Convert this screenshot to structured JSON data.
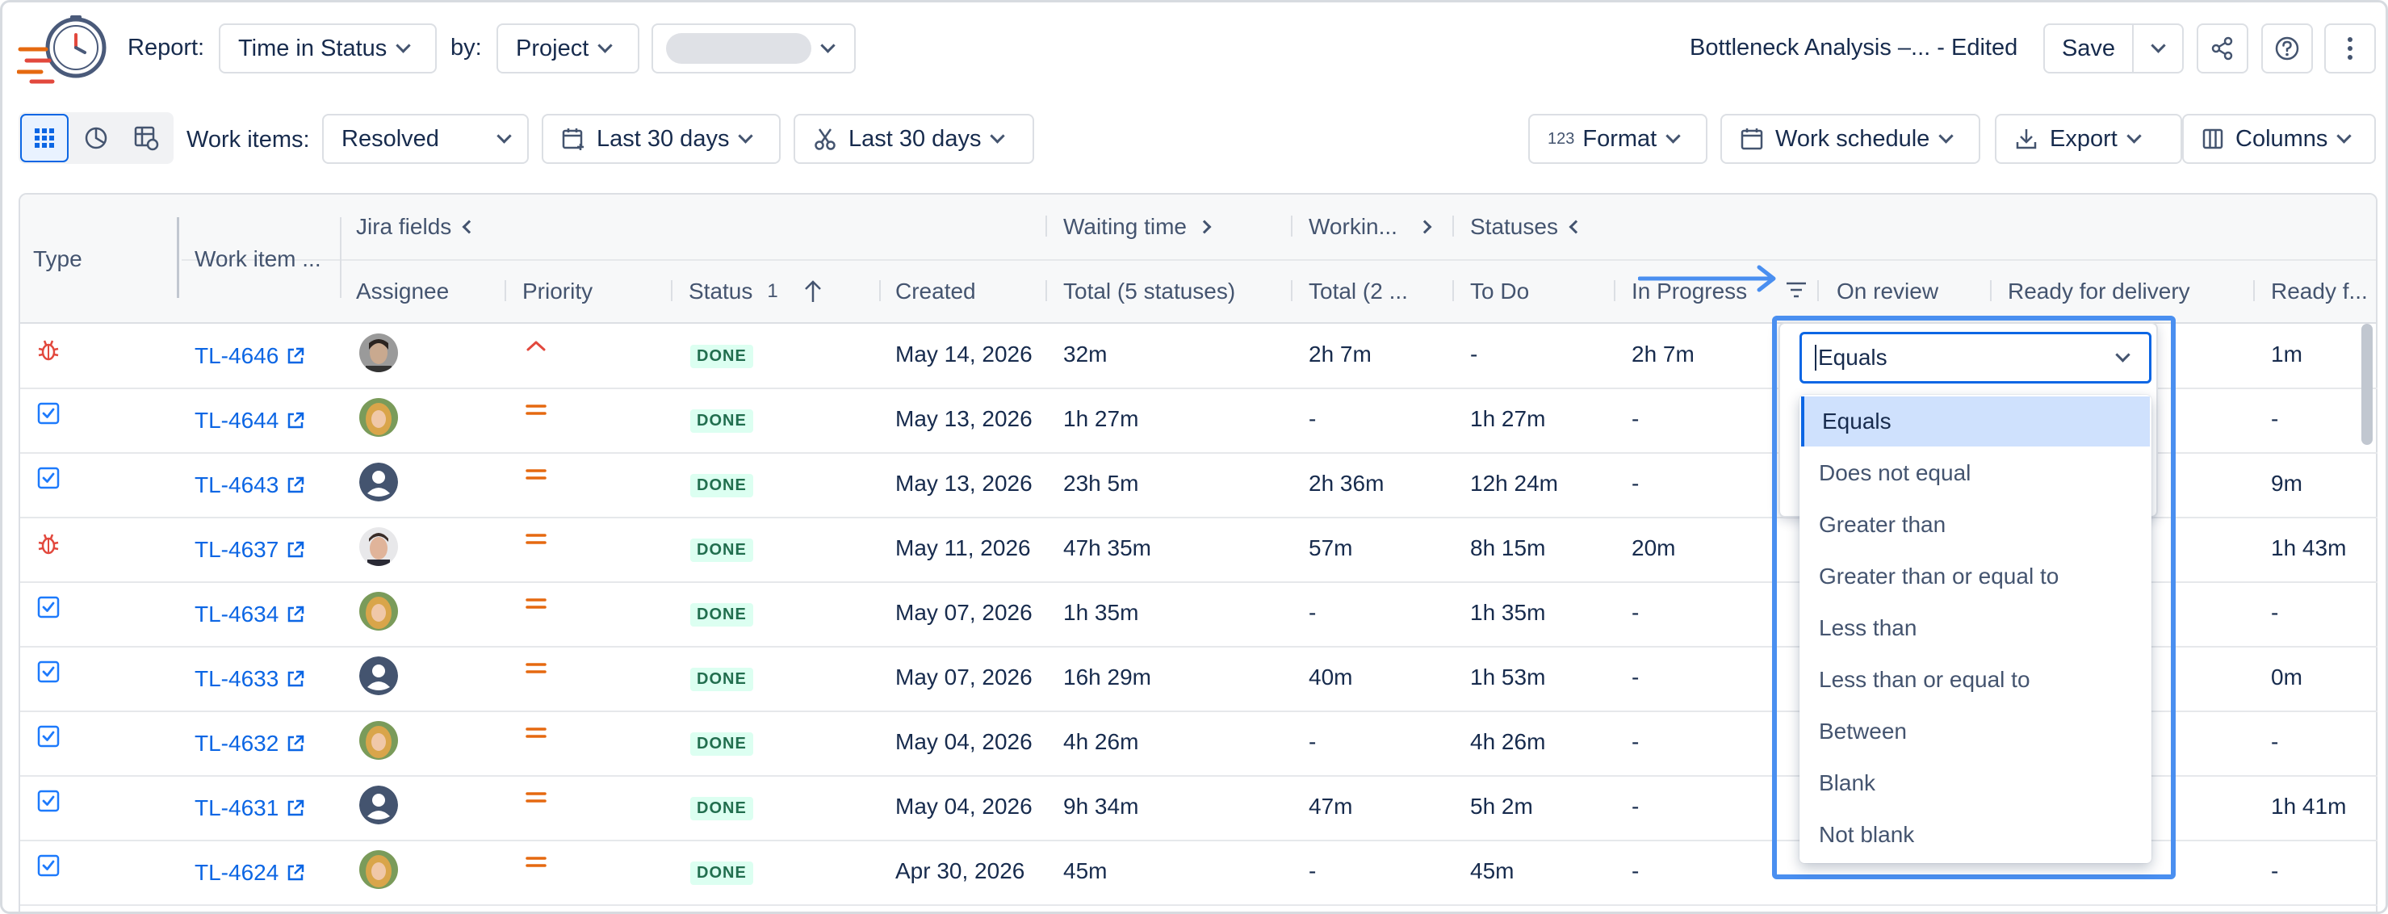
{
  "header": {
    "report_label": "Report:",
    "report_value": "Time in Status",
    "by_label": "by:",
    "by_value": "Project",
    "project_placeholder": "",
    "title": "Bottleneck Analysis –... - Edited",
    "save_label": "Save"
  },
  "toolbar": {
    "work_items_label": "Work items:",
    "work_items_value": "Resolved",
    "date_filter_1": "Last 30 days",
    "date_filter_2": "Last 30 days",
    "format_label": "Format",
    "format_icon_text": "123",
    "work_schedule_label": "Work schedule",
    "export_label": "Export",
    "columns_label": "Columns"
  },
  "table": {
    "groups": {
      "jira_fields": "Jira fields",
      "waiting_time": "Waiting time",
      "working": "Workin...",
      "statuses": "Statuses"
    },
    "columns": {
      "type": "Type",
      "work_item": "Work item ...",
      "assignee": "Assignee",
      "priority": "Priority",
      "status": "Status",
      "status_sort_index": "1",
      "created": "Created",
      "total_waiting": "Total (5 statuses)",
      "total_working": "Total (2 ...",
      "todo": "To Do",
      "in_progress": "In Progress",
      "on_review": "On review",
      "ready_for_delivery": "Ready for delivery",
      "ready_f": "Ready f..."
    },
    "rows": [
      {
        "type": "bug",
        "key": "TL-4646",
        "avatar": "photo-dark",
        "priority": "high",
        "status": "DONE",
        "created": "May 14, 2026",
        "waiting": "32m",
        "working": "2h 7m",
        "todo": "-",
        "in_progress": "2h 7m",
        "last": "1m"
      },
      {
        "type": "task",
        "key": "TL-4644",
        "avatar": "photo-blonde",
        "priority": "medium",
        "status": "DONE",
        "created": "May 13, 2026",
        "waiting": "1h 27m",
        "working": "-",
        "todo": "1h 27m",
        "in_progress": "-",
        "last": "-"
      },
      {
        "type": "task",
        "key": "TL-4643",
        "avatar": "default",
        "priority": "medium",
        "status": "DONE",
        "created": "May 13, 2026",
        "waiting": "23h 5m",
        "working": "2h 36m",
        "todo": "12h 24m",
        "in_progress": "-",
        "last": "9m"
      },
      {
        "type": "bug",
        "key": "TL-4637",
        "avatar": "photo-man",
        "priority": "medium",
        "status": "DONE",
        "created": "May 11, 2026",
        "waiting": "47h 35m",
        "working": "57m",
        "todo": "8h 15m",
        "in_progress": "20m",
        "last": "1h 43m"
      },
      {
        "type": "task",
        "key": "TL-4634",
        "avatar": "photo-blonde",
        "priority": "medium",
        "status": "DONE",
        "created": "May 07, 2026",
        "waiting": "1h 35m",
        "working": "-",
        "todo": "1h 35m",
        "in_progress": "-",
        "last": "-"
      },
      {
        "type": "task",
        "key": "TL-4633",
        "avatar": "default",
        "priority": "medium",
        "status": "DONE",
        "created": "May 07, 2026",
        "waiting": "16h 29m",
        "working": "40m",
        "todo": "1h 53m",
        "in_progress": "-",
        "last": "0m"
      },
      {
        "type": "task",
        "key": "TL-4632",
        "avatar": "photo-blonde",
        "priority": "medium",
        "status": "DONE",
        "created": "May 04, 2026",
        "waiting": "4h 26m",
        "working": "-",
        "todo": "4h 26m",
        "in_progress": "-",
        "last": "-"
      },
      {
        "type": "task",
        "key": "TL-4631",
        "avatar": "default",
        "priority": "medium",
        "status": "DONE",
        "created": "May 04, 2026",
        "waiting": "9h 34m",
        "working": "47m",
        "todo": "5h 2m",
        "in_progress": "-",
        "last": "1h 41m"
      },
      {
        "type": "task",
        "key": "TL-4624",
        "avatar": "photo-blonde",
        "priority": "medium",
        "status": "DONE",
        "created": "Apr 30, 2026",
        "waiting": "45m",
        "working": "-",
        "todo": "45m",
        "in_progress": "-",
        "last": "-"
      }
    ]
  },
  "filter_dropdown": {
    "selected": "Equals",
    "options": [
      "Equals",
      "Does not equal",
      "Greater than",
      "Greater than or equal to",
      "Less than",
      "Less than or equal to",
      "Between",
      "Blank",
      "Not blank"
    ]
  },
  "colors": {
    "accent": "#0c66e4",
    "highlight_frame": "#4a8ff0",
    "bug": "#e2483d",
    "priority": "#e56910",
    "done_bg": "#dcfff1",
    "done_text": "#216e4e"
  }
}
